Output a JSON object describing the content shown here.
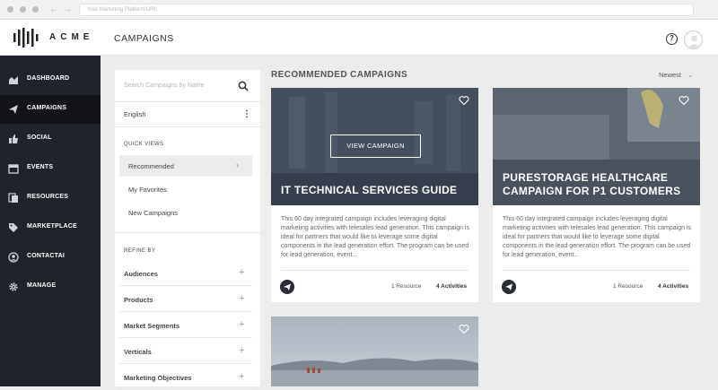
{
  "browser": {
    "url_placeholder": "Your Marketing Platform URL"
  },
  "header": {
    "brand": "ACME",
    "title": "CAMPAIGNS",
    "help_glyph": "?"
  },
  "sidebar": {
    "items": [
      {
        "label": "DASHBOARD",
        "icon": "chart-icon",
        "active": false
      },
      {
        "label": "CAMPAIGNS",
        "icon": "paper-plane-icon",
        "active": true
      },
      {
        "label": "SOCIAL",
        "icon": "thumbs-up-icon",
        "active": false
      },
      {
        "label": "EVENTS",
        "icon": "calendar-icon",
        "active": false
      },
      {
        "label": "RESOURCES",
        "icon": "resources-icon",
        "active": false
      },
      {
        "label": "MARKETPLACE",
        "icon": "tag-icon",
        "active": false
      },
      {
        "label": "CONTACTAI",
        "icon": "contact-icon",
        "active": false
      },
      {
        "label": "MANAGE",
        "icon": "gear-icon",
        "active": false
      }
    ]
  },
  "filters": {
    "search_placeholder": "Search Campaigns by Name",
    "language": "English",
    "quick_views_title": "QUICK VIEWS",
    "quick_views": [
      "Recommended",
      "My Favorites",
      "New Campaigns"
    ],
    "refine_title": "REFINE BY",
    "refine": [
      "Audiences",
      "Products",
      "Market Segments",
      "Verticals",
      "Marketing Objectives"
    ]
  },
  "main": {
    "section_title": "RECOMMENDED CAMPAIGNS",
    "sort_label": "Newest",
    "sort_chevron": "⌄",
    "view_button": "VIEW CAMPAIGN",
    "cards": [
      {
        "title": "IT TECHNICAL SERVICES GUIDE",
        "description": "This 60 day integrated campaign includes leveraging digital marketing activities with telesales lead generation.  This campaign is ideal for  partners that would like to leverage some digital components in the lead generation effort. The program can be used for lead generation, event...",
        "resources": "1 Resource",
        "activities": "4 Activities"
      },
      {
        "title_line1": "PURESTORAGE HEALTHCARE",
        "title_line2": "CAMPAIGN FOR P1 CUSTOMERS",
        "description": "This 60 day integrated campaign includes leveraging digital marketing activities with telesales lead generation.  This campaign is ideal for  partners that would like to leverage some digital components in the lead generation effort. The program can be used for lead generation, event...",
        "resources": "1 Resource",
        "activities": "4 Activities"
      }
    ]
  }
}
